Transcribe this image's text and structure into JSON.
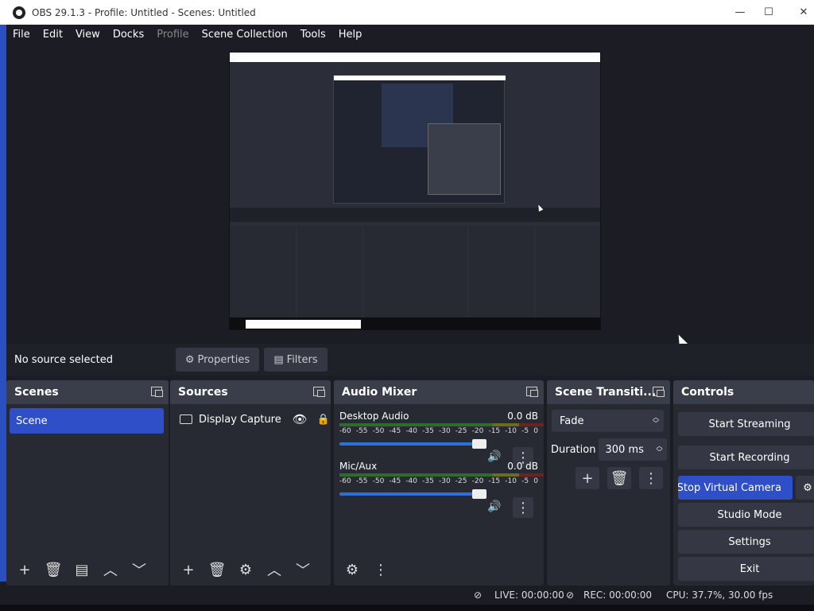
{
  "window": {
    "title": "OBS 29.1.3 - Profile: Untitled - Scenes: Untitled",
    "minimize": "—",
    "maximize": "☐",
    "close": "✕"
  },
  "menu": [
    "File",
    "Edit",
    "View",
    "Docks",
    "Profile",
    "Scene Collection",
    "Tools",
    "Help"
  ],
  "source_bar": {
    "label": "No source selected",
    "properties": "Properties",
    "filters": "Filters"
  },
  "scenes": {
    "title": "Scenes",
    "items": [
      "Scene"
    ]
  },
  "sources": {
    "title": "Sources",
    "items": [
      "Display Capture"
    ]
  },
  "audio": {
    "title": "Audio Mixer",
    "channels": [
      {
        "name": "Desktop Audio",
        "db": "0.0 dB"
      },
      {
        "name": "Mic/Aux",
        "db": "0.0 dB"
      }
    ],
    "ticks": [
      "-60",
      "-55",
      "-50",
      "-45",
      "-40",
      "-35",
      "-30",
      "-25",
      "-20",
      "-15",
      "-10",
      "-5",
      "0"
    ]
  },
  "transitions": {
    "title": "Scene Transiti...",
    "selected": "Fade",
    "duration_label": "Duration",
    "duration_value": "300 ms"
  },
  "controls": {
    "title": "Controls",
    "start_streaming": "Start Streaming",
    "start_recording": "Start Recording",
    "virtual_camera": "Stop Virtual Camera",
    "studio_mode": "Studio Mode",
    "settings": "Settings",
    "exit": "Exit"
  },
  "status": {
    "live": "LIVE: 00:00:00",
    "rec": "REC: 00:00:00",
    "cpu": "CPU: 37.7%, 30.00 fps"
  },
  "colors": {
    "accent": "#2e4fc7",
    "background": "#1b1c24",
    "panel": "#272a33"
  }
}
